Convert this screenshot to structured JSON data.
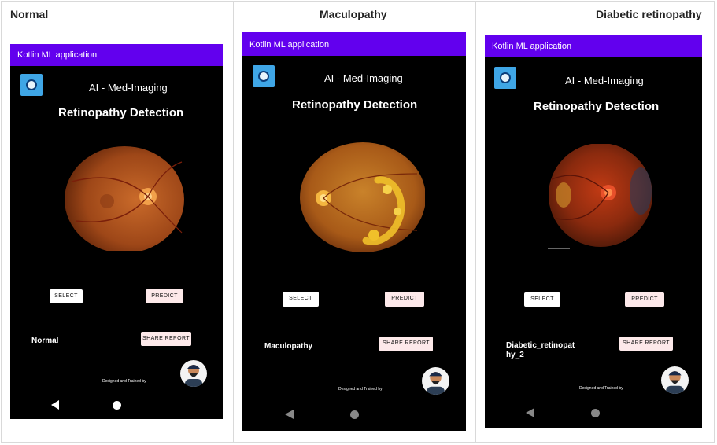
{
  "headers": [
    "Normal",
    "Maculopathy",
    "Diabetic retinopathy"
  ],
  "colors": {
    "appbar": "#6200ee",
    "logo_bg": "#3fa6e6",
    "fundus": "#b0521e",
    "exudate": "#f0c02a",
    "predict_bg": "#fde9ea"
  },
  "panels": [
    {
      "appbar_title": "Kotlin ML application",
      "heading": "AI - Med-Imaging",
      "title": "Retinopathy Detection",
      "select_label": "SELECT",
      "predict_label": "PREDICT",
      "share_label": "SHARE REPORT",
      "result": "Normal",
      "credit": "Designed and Trained by",
      "image_icon": "fundus-image-normal",
      "nav": {
        "back": "back-icon",
        "home": "home-icon"
      }
    },
    {
      "appbar_title": "Kotlin ML application",
      "heading": "AI - Med-Imaging",
      "title": "Retinopathy Detection",
      "select_label": "SELECT",
      "predict_label": "PREDICT",
      "share_label": "SHARE REPORT",
      "result": "Maculopathy",
      "credit": "Designed and Trained by",
      "image_icon": "fundus-image-maculopathy",
      "nav": {
        "back": "back-icon",
        "home": "home-icon"
      }
    },
    {
      "appbar_title": "Kotlin ML application",
      "heading": "AI - Med-Imaging",
      "title": "Retinopathy Detection",
      "select_label": "SELECT",
      "predict_label": "PREDICT",
      "share_label": "SHARE REPORT",
      "result": "Diabetic_retinopat hy_2",
      "credit": "Designed and Trained by",
      "image_icon": "fundus-image-diabetic-retinopathy",
      "nav": {
        "back": "back-icon",
        "home": "home-icon"
      }
    }
  ]
}
